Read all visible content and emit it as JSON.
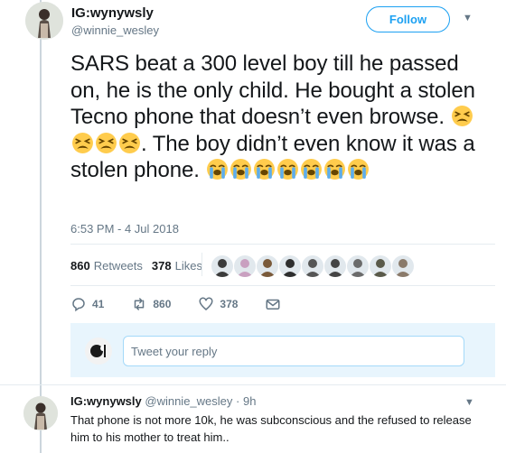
{
  "tweet": {
    "display_name": "IG:wynywsly",
    "handle": "@winnie_wesley",
    "follow_label": "Follow",
    "text_segments": [
      "SARS beat a 300 level boy till he passed on, he is the only child. He bought a stolen Tecno phone that doesn’t even browse. ",
      ". The boy didn’t even know it was a stolen phone. "
    ],
    "emoji_groups": [
      [
        "tired-face-emoji",
        "tired-face-emoji",
        "tired-face-emoji",
        "tired-face-emoji"
      ],
      [
        "loudly-crying-face-emoji",
        "loudly-crying-face-emoji",
        "loudly-crying-face-emoji",
        "loudly-crying-face-emoji",
        "loudly-crying-face-emoji",
        "loudly-crying-face-emoji",
        "loudly-crying-face-emoji"
      ]
    ],
    "timestamp": "6:53 PM - 4 Jul 2018",
    "retweets_count": "860",
    "retweets_label": "Retweets",
    "likes_count": "378",
    "likes_label": "Likes",
    "liker_avatars": [
      "#3b3b3b",
      "#c9a0c0",
      "#7a5a3a",
      "#2e2e2e",
      "#555555",
      "#444444",
      "#6b6b6b",
      "#5a5a4a",
      "#8a7a6a"
    ]
  },
  "actions": {
    "reply_count": "41",
    "retweet_count": "860",
    "like_count": "378"
  },
  "reply_box": {
    "placeholder": "Tweet your reply"
  },
  "reply": {
    "display_name": "IG:wynywsly",
    "handle": "@winnie_wesley",
    "separator": "·",
    "time": "9h",
    "text": "That phone is not more 10k, he was subconscious and the refused to release him to his mother to treat him.."
  },
  "colors": {
    "accent": "#1da1f2",
    "muted": "#657786",
    "text": "#14171a"
  }
}
